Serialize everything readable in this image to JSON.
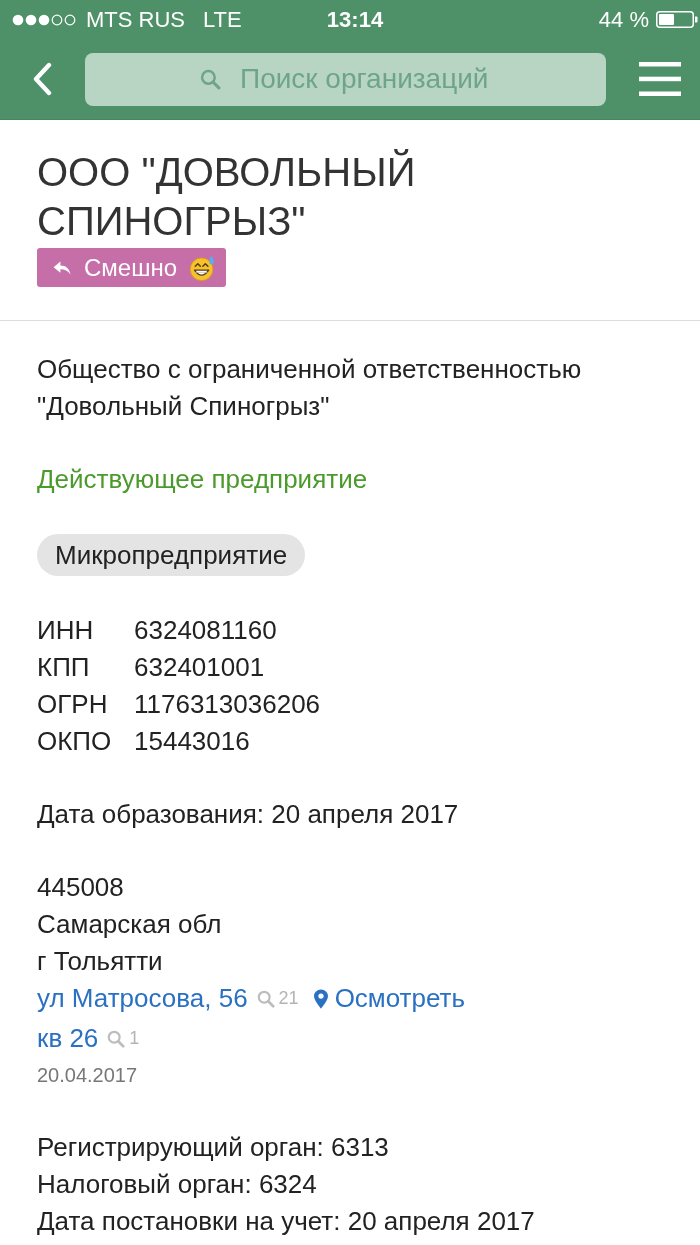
{
  "status_bar": {
    "carrier": "MTS RUS",
    "network": "LTE",
    "time": "13:14",
    "battery": "44 %"
  },
  "nav_bar": {
    "search": {
      "placeholder": "Поиск организаций"
    }
  },
  "header": {
    "title": "ООО \"ДОВОЛЬНЫЙ СПИНОГРЫЗ\"",
    "reaction": {
      "label": "Смешно"
    }
  },
  "full_name": "Общество с ограниченной ответственностью \"Довольный Спиногрыз\"",
  "status": "Действующее предприятие",
  "category_tag": "Микропредприятие",
  "codes": [
    {
      "label": "ИНН",
      "value": "6324081160"
    },
    {
      "label": "КПП",
      "value": "632401001"
    },
    {
      "label": "ОГРН",
      "value": "1176313036206"
    },
    {
      "label": "ОКПО",
      "value": "15443016"
    }
  ],
  "founded": "Дата образования: 20 апреля 2017",
  "address": {
    "lines": [
      {
        "kind": "text",
        "text": "445008"
      },
      {
        "kind": "text",
        "text": "Самарская обл"
      },
      {
        "kind": "text",
        "text": "г Тольятти"
      },
      {
        "kind": "link",
        "text": "ул Матросова, 56",
        "count": "21",
        "map_link": "Осмотреть"
      },
      {
        "kind": "link",
        "text": "кв 26",
        "count": "1"
      }
    ],
    "date": "20.04.2017"
  },
  "registration": [
    "Регистрирующий орган: 6313",
    "Налоговый орган: 6324",
    "Дата постановки на учет: 20 апреля 2017"
  ]
}
